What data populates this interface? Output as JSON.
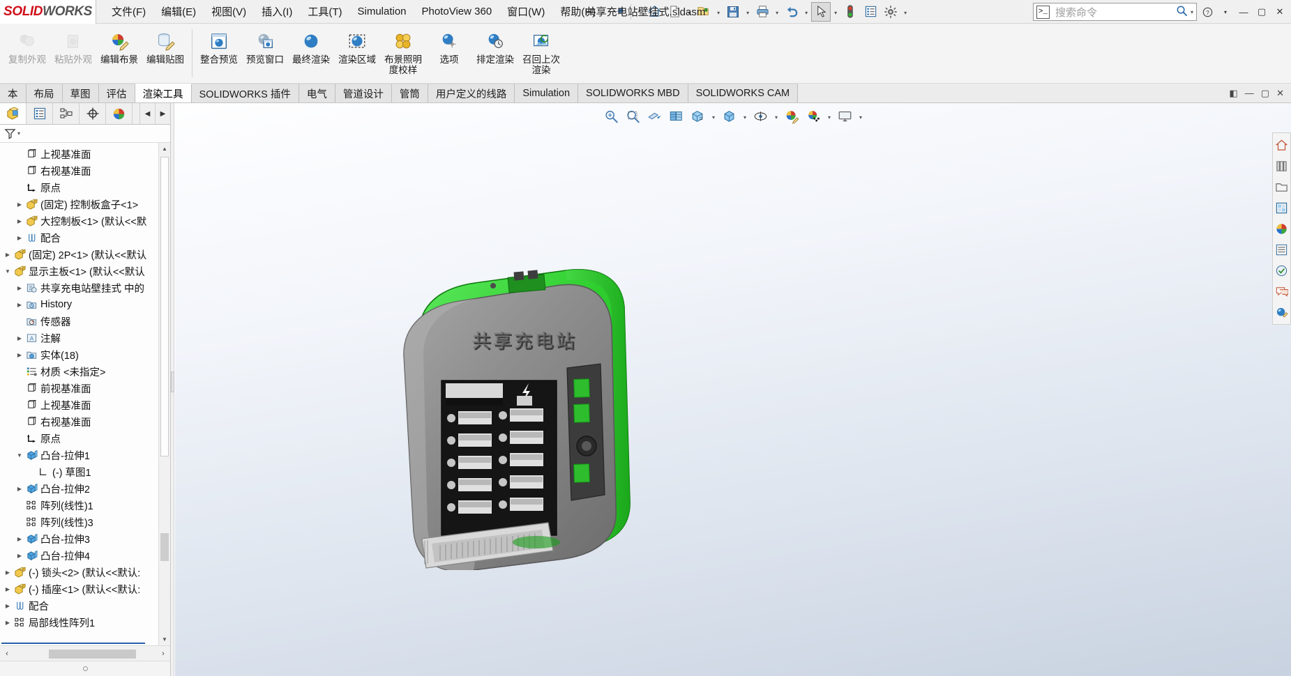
{
  "app": {
    "brand_solid": "SOLID",
    "brand_works": "WORKS",
    "document_title": "共享充电站壁挂式.sldasm"
  },
  "menu": {
    "items": [
      {
        "label": "文件(F)",
        "name": "menu-file"
      },
      {
        "label": "编辑(E)",
        "name": "menu-edit"
      },
      {
        "label": "视图(V)",
        "name": "menu-view"
      },
      {
        "label": "插入(I)",
        "name": "menu-insert"
      },
      {
        "label": "工具(T)",
        "name": "menu-tools"
      },
      {
        "label": "Simulation",
        "name": "menu-simulation"
      },
      {
        "label": "PhotoView 360",
        "name": "menu-photoview"
      },
      {
        "label": "窗口(W)",
        "name": "menu-window"
      },
      {
        "label": "帮助(H)",
        "name": "menu-help"
      }
    ],
    "pin_icon": "pushpin-icon"
  },
  "quick_access": {
    "buttons": [
      {
        "name": "home-button",
        "icon": "home-icon",
        "caret": false
      },
      {
        "name": "new-document-button",
        "icon": "new-file-icon",
        "caret": true
      },
      {
        "name": "open-document-button",
        "icon": "open-folder-icon",
        "caret": true
      },
      {
        "name": "save-button",
        "icon": "save-floppy-icon",
        "caret": true
      },
      {
        "name": "print-button",
        "icon": "printer-icon",
        "caret": true
      },
      {
        "name": "undo-button",
        "icon": "undo-arrow-icon",
        "caret": true
      },
      {
        "name": "select-button",
        "icon": "cursor-arrow-icon",
        "caret": true
      },
      {
        "name": "rebuild-button",
        "icon": "traffic-light-icon",
        "caret": false
      },
      {
        "name": "file-properties-button",
        "icon": "properties-list-icon",
        "caret": false
      },
      {
        "name": "options-button",
        "icon": "gear-icon",
        "caret": true
      }
    ]
  },
  "search": {
    "placeholder": "搜索命令",
    "prompt_glyph": ">_",
    "magnifier_icon": "magnifier-icon",
    "dropdown_icon": "chevron-down-icon"
  },
  "window_controls": {
    "restore_outer": "⧉",
    "minimize": "—",
    "maximize": "▢",
    "close": "✕"
  },
  "ribbon": {
    "groups": [
      {
        "name": "appearance-group",
        "buttons": [
          {
            "label": "复制外观",
            "name": "copy-appearance-button",
            "icon": "copy-appearance-icon",
            "disabled": true
          },
          {
            "label": "粘贴外观",
            "name": "paste-appearance-button",
            "icon": "paste-appearance-icon",
            "disabled": true
          },
          {
            "label": "编辑布景",
            "name": "edit-scene-button",
            "icon": "edit-scene-icon",
            "disabled": false
          },
          {
            "label": "编辑贴图",
            "name": "edit-decal-button",
            "icon": "edit-decal-icon",
            "disabled": false
          }
        ]
      },
      {
        "name": "render-group",
        "buttons": [
          {
            "label": "整合预览",
            "name": "integrated-preview-button",
            "icon": "integrated-preview-icon",
            "disabled": false
          },
          {
            "label": "预览窗口",
            "name": "preview-window-button",
            "icon": "preview-window-icon",
            "disabled": false
          },
          {
            "label": "最终渲染",
            "name": "final-render-button",
            "icon": "final-render-icon",
            "disabled": false
          },
          {
            "label": "渲染区域",
            "name": "render-region-button",
            "icon": "render-region-icon",
            "disabled": false
          },
          {
            "label": "布景照明度校样",
            "name": "scene-illumination-proof-button",
            "icon": "scene-lighting-icon",
            "disabled": false
          },
          {
            "label": "选项",
            "name": "render-options-button",
            "icon": "render-options-icon",
            "disabled": false
          },
          {
            "label": "排定渲染",
            "name": "schedule-render-button",
            "icon": "schedule-render-icon",
            "disabled": false
          },
          {
            "label": "召回上次渲染",
            "name": "recall-last-render-button",
            "icon": "recall-render-icon",
            "disabled": false
          }
        ]
      }
    ]
  },
  "tabs": {
    "items": [
      {
        "label": "本",
        "name": "tab-assembly-partial",
        "active": false
      },
      {
        "label": "布局",
        "name": "tab-layout",
        "active": false
      },
      {
        "label": "草图",
        "name": "tab-sketch",
        "active": false
      },
      {
        "label": "评估",
        "name": "tab-evaluate",
        "active": false
      },
      {
        "label": "渲染工具",
        "name": "tab-render-tools",
        "active": true
      },
      {
        "label": "SOLIDWORKS 插件",
        "name": "tab-solidworks-addins",
        "active": false
      },
      {
        "label": "电气",
        "name": "tab-electrical",
        "active": false
      },
      {
        "label": "管道设计",
        "name": "tab-routing-piping",
        "active": false
      },
      {
        "label": "管筒",
        "name": "tab-tubing",
        "active": false
      },
      {
        "label": "用户定义的线路",
        "name": "tab-user-defined-route",
        "active": false
      },
      {
        "label": "Simulation",
        "name": "tab-simulation",
        "active": false
      },
      {
        "label": "SOLIDWORKS MBD",
        "name": "tab-solidworks-mbd",
        "active": false
      },
      {
        "label": "SOLIDWORKS CAM",
        "name": "tab-solidworks-cam",
        "active": false
      }
    ],
    "right_controls": [
      {
        "name": "collapse-ribbon-button",
        "glyph": "◧"
      },
      {
        "name": "minimize-doc-button",
        "glyph": "—"
      },
      {
        "name": "restore-doc-button",
        "glyph": "▢"
      },
      {
        "name": "close-doc-button",
        "glyph": "✕"
      }
    ]
  },
  "feature_manager": {
    "tabs": [
      {
        "name": "feature-manager-tab",
        "icon": "feature-tree-icon",
        "active": true
      },
      {
        "name": "property-manager-tab",
        "icon": "property-list-icon",
        "active": false
      },
      {
        "name": "configuration-manager-tab",
        "icon": "configuration-icon",
        "active": false
      },
      {
        "name": "dimxpert-manager-tab",
        "icon": "dimxpert-target-icon",
        "active": false
      },
      {
        "name": "display-manager-tab",
        "icon": "display-palette-icon",
        "active": false
      }
    ],
    "arrows": [
      {
        "name": "fm-scroll-left-button",
        "glyph": "◀"
      },
      {
        "name": "fm-scroll-right-button",
        "glyph": "▶"
      }
    ],
    "filter": {
      "name": "filter-icon",
      "caret": "▾"
    }
  },
  "tree": {
    "rows": [
      {
        "label": "上视基准面",
        "indent": 2,
        "twist": "",
        "icon": "plane-icon",
        "name": "tree-item-top-plane"
      },
      {
        "label": "右视基准面",
        "indent": 2,
        "twist": "",
        "icon": "plane-icon",
        "name": "tree-item-right-plane"
      },
      {
        "label": "原点",
        "indent": 2,
        "twist": "",
        "icon": "origin-icon",
        "name": "tree-item-origin"
      },
      {
        "label": "(固定) 控制板盒子<1>",
        "indent": 2,
        "twist": "▶",
        "icon": "part-icon",
        "name": "tree-item-control-panel-box"
      },
      {
        "label": "大控制板<1> (默认<<默",
        "indent": 2,
        "twist": "▶",
        "icon": "part-icon",
        "name": "tree-item-large-control-panel"
      },
      {
        "label": "配合",
        "indent": 2,
        "twist": "▶",
        "icon": "mates-icon",
        "name": "tree-item-mates-1"
      },
      {
        "label": "(固定) 2P<1> (默认<<默认",
        "indent": 1,
        "twist": "▶",
        "icon": "part-icon",
        "name": "tree-item-2p"
      },
      {
        "label": "显示主板<1> (默认<<默认",
        "indent": 1,
        "twist": "▼",
        "icon": "part-icon",
        "name": "tree-item-display-mainboard"
      },
      {
        "label": "共享充电站壁挂式 中的",
        "indent": 2,
        "twist": "▶",
        "icon": "in-context-icon",
        "name": "tree-item-in-context"
      },
      {
        "label": "History",
        "indent": 2,
        "twist": "▶",
        "icon": "history-icon",
        "name": "tree-item-history"
      },
      {
        "label": "传感器",
        "indent": 2,
        "twist": "",
        "icon": "sensor-icon",
        "name": "tree-item-sensors"
      },
      {
        "label": "注解",
        "indent": 2,
        "twist": "▶",
        "icon": "annotations-icon",
        "name": "tree-item-annotations"
      },
      {
        "label": "实体(18)",
        "indent": 2,
        "twist": "▶",
        "icon": "solid-bodies-icon",
        "name": "tree-item-solid-bodies"
      },
      {
        "label": "材质 <未指定>",
        "indent": 2,
        "twist": "",
        "icon": "material-icon",
        "name": "tree-item-material"
      },
      {
        "label": "前视基准面",
        "indent": 2,
        "twist": "",
        "icon": "plane-icon",
        "name": "tree-item-front-plane-2"
      },
      {
        "label": "上视基准面",
        "indent": 2,
        "twist": "",
        "icon": "plane-icon",
        "name": "tree-item-top-plane-2"
      },
      {
        "label": "右视基准面",
        "indent": 2,
        "twist": "",
        "icon": "plane-icon",
        "name": "tree-item-right-plane-2"
      },
      {
        "label": "原点",
        "indent": 2,
        "twist": "",
        "icon": "origin-icon",
        "name": "tree-item-origin-2"
      },
      {
        "label": "凸台-拉伸1",
        "indent": 2,
        "twist": "▼",
        "icon": "extrude-icon",
        "name": "tree-item-boss-extrude-1"
      },
      {
        "label": "(-) 草图1",
        "indent": 3,
        "twist": "",
        "icon": "sketch-icon",
        "name": "tree-item-sketch-1"
      },
      {
        "label": "凸台-拉伸2",
        "indent": 2,
        "twist": "▶",
        "icon": "extrude-icon",
        "name": "tree-item-boss-extrude-2"
      },
      {
        "label": "阵列(线性)1",
        "indent": 2,
        "twist": "",
        "icon": "linear-pattern-icon",
        "name": "tree-item-linear-pattern-1"
      },
      {
        "label": "阵列(线性)3",
        "indent": 2,
        "twist": "",
        "icon": "linear-pattern-icon",
        "name": "tree-item-linear-pattern-3"
      },
      {
        "label": "凸台-拉伸3",
        "indent": 2,
        "twist": "▶",
        "icon": "extrude-icon",
        "name": "tree-item-boss-extrude-3"
      },
      {
        "label": "凸台-拉伸4",
        "indent": 2,
        "twist": "▶",
        "icon": "extrude-icon",
        "name": "tree-item-boss-extrude-4"
      },
      {
        "label": "(-) 锁头<2> (默认<<默认:",
        "indent": 1,
        "twist": "▶",
        "icon": "part-icon",
        "name": "tree-item-lock-head"
      },
      {
        "label": "(-) 插座<1> (默认<<默认:",
        "indent": 1,
        "twist": "▶",
        "icon": "part-icon",
        "name": "tree-item-socket"
      },
      {
        "label": "配合",
        "indent": 1,
        "twist": "▶",
        "icon": "mates-icon",
        "name": "tree-item-mates-2"
      },
      {
        "label": "局部线性阵列1",
        "indent": 1,
        "twist": "▶",
        "icon": "linear-pattern-icon",
        "name": "tree-item-local-linear-pattern-1"
      }
    ]
  },
  "viewport_toolbar": {
    "buttons": [
      {
        "name": "zoom-to-fit-button",
        "icon": "zoom-to-fit-icon",
        "caret": false
      },
      {
        "name": "zoom-to-area-button",
        "icon": "zoom-to-area-icon",
        "caret": false
      },
      {
        "name": "section-view-button",
        "icon": "section-view-icon",
        "caret": false
      },
      {
        "name": "view-orientation-button",
        "icon": "view-orientation-icon",
        "caret": false
      },
      {
        "name": "display-style-button",
        "icon": "display-style-icon",
        "caret": true
      },
      {
        "name": "hide-show-items-button",
        "icon": "hide-show-cube-icon",
        "caret": true
      },
      {
        "name": "edit-appearance-button",
        "icon": "eye-appearance-icon",
        "caret": true
      },
      {
        "name": "apply-scene-button",
        "icon": "apply-scene-icon",
        "caret": false
      },
      {
        "name": "view-settings-button",
        "icon": "view-settings-palette-icon",
        "caret": true
      },
      {
        "name": "viewport-layout-button",
        "icon": "monitor-layout-icon",
        "caret": true
      }
    ]
  },
  "right_dock": {
    "buttons": [
      {
        "name": "solidworks-resources-button",
        "icon": "home-resources-icon"
      },
      {
        "name": "design-library-button",
        "icon": "library-books-icon"
      },
      {
        "name": "file-explorer-button",
        "icon": "file-explorer-icon"
      },
      {
        "name": "view-palette-button",
        "icon": "view-palette-icon"
      },
      {
        "name": "appearances-scenes-button",
        "icon": "appearances-sphere-icon"
      },
      {
        "name": "custom-properties-button",
        "icon": "custom-properties-icon"
      },
      {
        "name": "dfm-button",
        "icon": "dfm-icon"
      },
      {
        "name": "sw-forum-button",
        "icon": "forum-icon"
      },
      {
        "name": "render-tools-button",
        "icon": "render-tools-icon"
      }
    ]
  },
  "model": {
    "device_label": "共享充电站",
    "shell_color": "#2bc92b",
    "body_color": "#8a8a8a",
    "screen_color": "#1a1a1a"
  }
}
